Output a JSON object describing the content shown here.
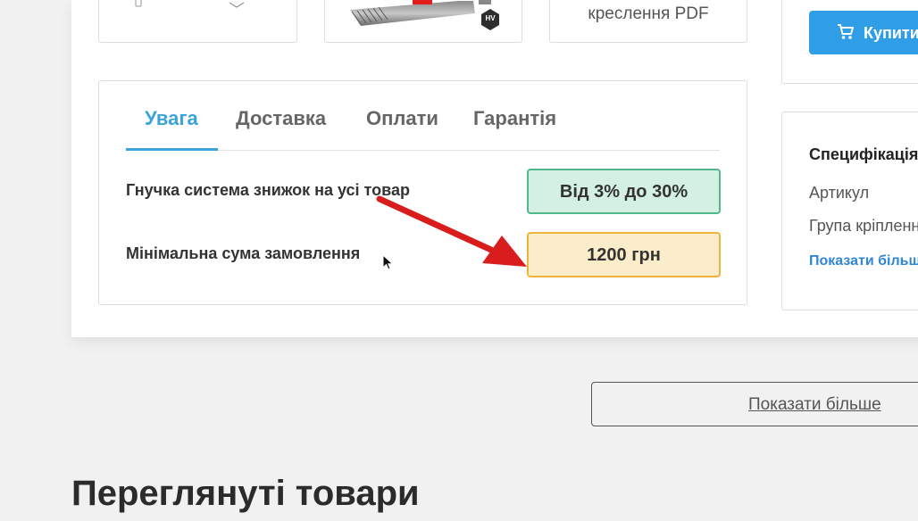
{
  "thumbnails": {
    "pdf_label": "креслення PDF",
    "badge_label": "HV"
  },
  "buy": {
    "button_label": "Купити",
    "icon": "cart-icon"
  },
  "info": {
    "tabs": [
      {
        "label": "Увага",
        "active": true
      },
      {
        "label": "Доставка",
        "active": false
      },
      {
        "label": "Оплати",
        "active": false
      },
      {
        "label": "Гарантія",
        "active": false
      }
    ],
    "rows": [
      {
        "label": "Гнучка система знижок на усі товар",
        "value": "Від 3% до 30%",
        "color": "#d3f0e3"
      },
      {
        "label": "Мінімальна сума замовлення",
        "value": "1200 грн",
        "color": "#fbedc9"
      }
    ]
  },
  "specs": {
    "title": "Специфікація",
    "lines": [
      "Артикул",
      "Група кріплення"
    ],
    "show_more": "Показати більше"
  },
  "show_more_button": "Показати більше",
  "viewed_section_title": "Переглянуті товари",
  "colors": {
    "accent": "#3ba3d9",
    "buy_button": "#2f9ee6",
    "arrow": "#d91c1c"
  }
}
